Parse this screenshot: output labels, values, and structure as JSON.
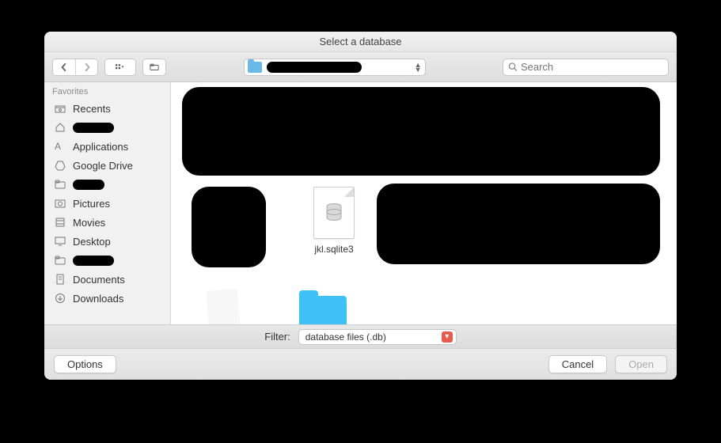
{
  "title": "Select a database",
  "toolbar": {
    "search_placeholder": "Search"
  },
  "sidebar": {
    "section": "Favorites",
    "items": [
      {
        "label": "Recents",
        "icon": "clock"
      },
      {
        "label": "",
        "icon": "home",
        "redacted": true
      },
      {
        "label": "Applications",
        "icon": "apps"
      },
      {
        "label": "Google Drive",
        "icon": "gdrive"
      },
      {
        "label": "",
        "icon": "folder",
        "redacted": true
      },
      {
        "label": "Pictures",
        "icon": "pictures"
      },
      {
        "label": "Movies",
        "icon": "movies"
      },
      {
        "label": "Desktop",
        "icon": "desktop"
      },
      {
        "label": "",
        "icon": "folder",
        "redacted": true
      },
      {
        "label": "Documents",
        "icon": "documents"
      },
      {
        "label": "Downloads",
        "icon": "downloads"
      }
    ]
  },
  "main": {
    "file_label": "jkl.sqlite3"
  },
  "filter": {
    "label": "Filter:",
    "value": "database files (.db)"
  },
  "footer": {
    "options": "Options",
    "cancel": "Cancel",
    "open": "Open"
  }
}
